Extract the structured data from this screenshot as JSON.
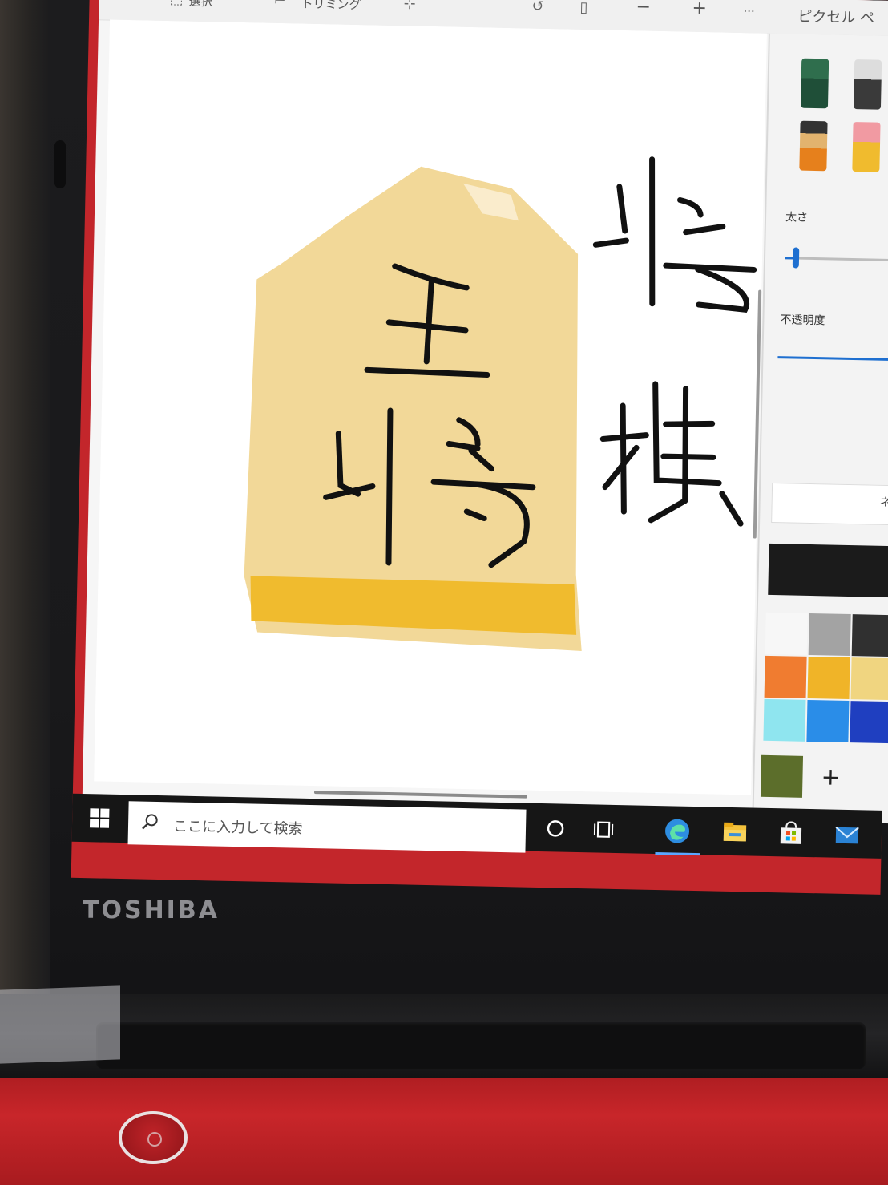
{
  "toolbar": {
    "select_label": "選択",
    "trim_label": "トリミング",
    "minus_label": "−",
    "plus_label": "+",
    "more_label": "···",
    "pixel_label": "ピクセル ペ"
  },
  "canvas": {
    "drawn_characters": [
      "王",
      "将",
      "将",
      "棋"
    ]
  },
  "tool_pane": {
    "size_label": "太さ",
    "size_value": 0.1,
    "opacity_label": "不透明度",
    "opacity_value": 1.0,
    "button_label": "ネ",
    "current_color": "#1b1b1b",
    "swatches": [
      "#f7f7f7",
      "#a3a3a3",
      "#303030",
      "#f07c30",
      "#f0b428",
      "#f0d580",
      "#8fe5ef",
      "#2a8de8",
      "#1f3fc0"
    ],
    "custom_swatch": "#5c6e2b",
    "add_color_label": "+"
  },
  "taskbar": {
    "search_placeholder": "ここに入力して検索"
  },
  "laptop": {
    "brand": "TOSHIBA"
  },
  "colors": {
    "chassis": "#c3262b",
    "piece_fill": "#f2d898",
    "piece_band": "#f0bb2e",
    "ink": "#111111",
    "accent": "#1e6fd0"
  }
}
